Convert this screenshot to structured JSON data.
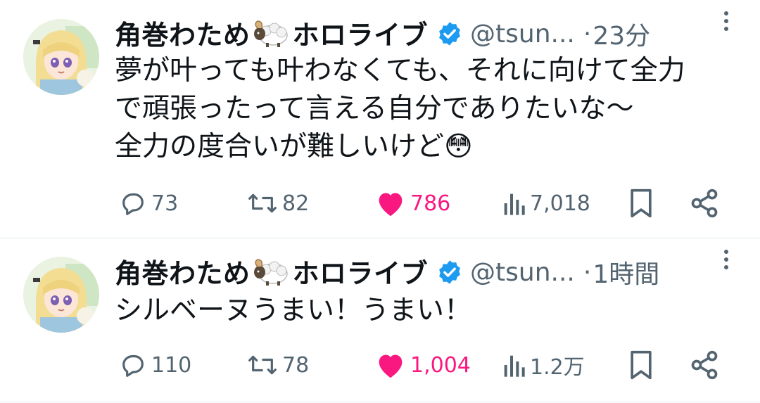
{
  "tweets": [
    {
      "author_name_prefix": "角巻わため",
      "author_name_suffix": "ホロライブ",
      "handle": "@tsun...",
      "separator": "·",
      "time": "23分",
      "text": "夢が叶っても叶わなくても、それに向けて全力\nで頑張ったって言える自分でありたいな〜\n全力の度合いが難しいけど😳",
      "replies": "73",
      "retweets": "82",
      "likes": "786",
      "views": "7,018",
      "liked": true
    },
    {
      "author_name_prefix": "角巻わため",
      "author_name_suffix": "ホロライブ",
      "handle": "@tsun...",
      "separator": "·",
      "time": "1時間",
      "text": "シルベーヌうまい！うまい！",
      "replies": "110",
      "retweets": "78",
      "likes": "1,004",
      "views": "1.2万",
      "liked": true
    }
  ],
  "colors": {
    "like_active": "#f91880",
    "verified_blue": "#1d9bf0",
    "muted_text": "#536471",
    "divider": "#e6ecf0"
  },
  "icons": [
    "reply-icon",
    "retweet-icon",
    "heart-icon",
    "views-icon",
    "bookmark-icon",
    "share-icon",
    "verified-icon",
    "more-icon",
    "sheep-emoji-icon"
  ]
}
